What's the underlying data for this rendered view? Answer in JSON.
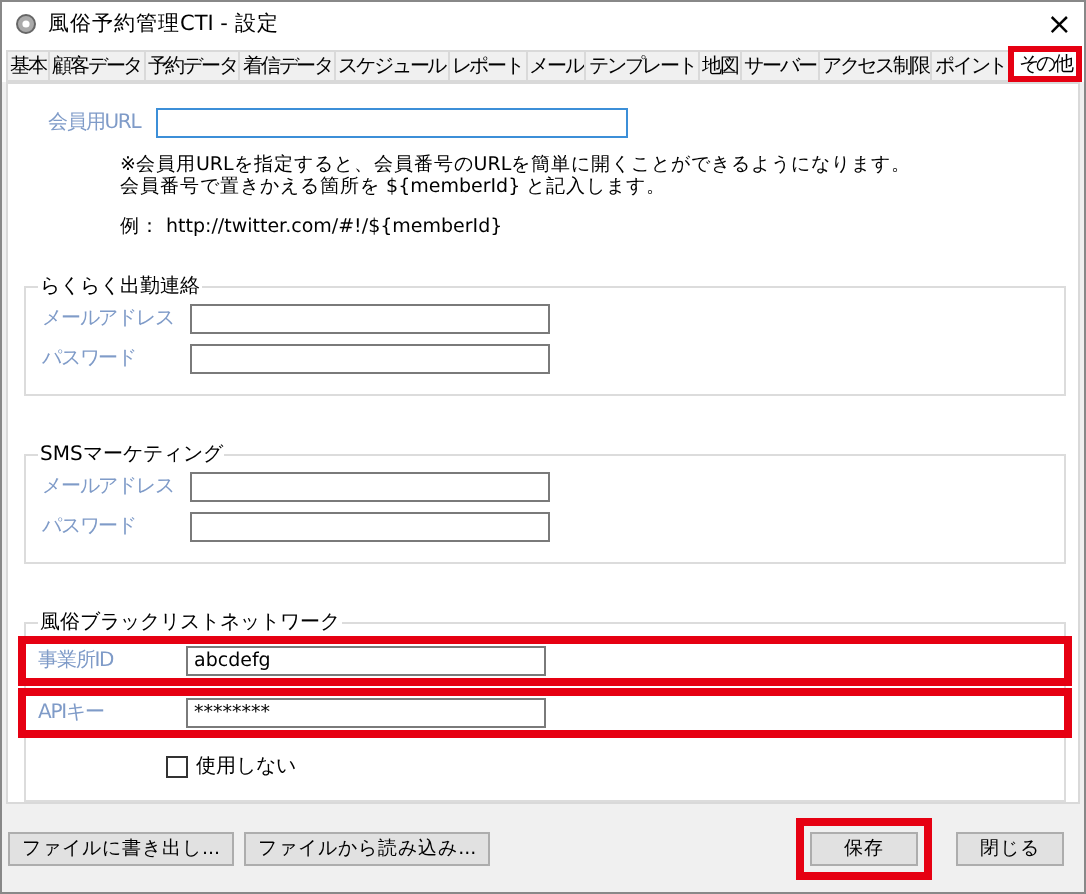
{
  "window": {
    "title": "風俗予約管理CTI - 設定",
    "close": "×"
  },
  "tabs": [
    {
      "label": "基本",
      "selected": false,
      "highlighted": false
    },
    {
      "label": "顧客データ",
      "selected": false,
      "highlighted": false
    },
    {
      "label": "予約データ",
      "selected": false,
      "highlighted": false
    },
    {
      "label": "着信データ",
      "selected": false,
      "highlighted": false
    },
    {
      "label": "スケジュール",
      "selected": false,
      "highlighted": false
    },
    {
      "label": "レポート",
      "selected": false,
      "highlighted": false
    },
    {
      "label": "メール",
      "selected": false,
      "highlighted": false
    },
    {
      "label": "テンプレート",
      "selected": false,
      "highlighted": false
    },
    {
      "label": "地図",
      "selected": false,
      "highlighted": false
    },
    {
      "label": "サーバー",
      "selected": false,
      "highlighted": false
    },
    {
      "label": "アクセス制限",
      "selected": false,
      "highlighted": false
    },
    {
      "label": "ポイント",
      "selected": false,
      "highlighted": false
    },
    {
      "label": "その他",
      "selected": true,
      "highlighted": true
    }
  ],
  "member_url": {
    "label": "会員用URL",
    "note_lines": [
      "※会員用URLを指定すると、会員番号のURLを簡単に開くことができるようになります。",
      "会員番号で置きかえる箇所を ${memberId} と記入します。"
    ],
    "example": "例： http://twitter.com/#!/${memberId}"
  },
  "groups": [
    {
      "title": "らくらく出勤連絡",
      "fields": [
        {
          "label": "メールアドレス",
          "highlighted": false
        },
        {
          "label": "パスワード",
          "highlighted": false
        }
      ]
    },
    {
      "title": "SMSマーケティング",
      "fields": [
        {
          "label": "メールアドレス",
          "highlighted": false
        },
        {
          "label": "パスワード",
          "highlighted": false
        }
      ]
    },
    {
      "title": "風俗ブラックリストネットワーク",
      "fields": [
        {
          "label": "事業所ID",
          "value": "abcdefg",
          "highlighted": true
        },
        {
          "label": "APIキー",
          "value": "********",
          "highlighted": true
        }
      ],
      "checkbox": {
        "label": "使用しない",
        "checked": false
      }
    }
  ],
  "footer": {
    "left_buttons": [
      {
        "label": "ファイルに書き出し...",
        "highlighted": false
      },
      {
        "label": "ファイルから読み込み...",
        "highlighted": false
      }
    ],
    "right_buttons": [
      {
        "label": "保存",
        "highlighted": true
      },
      {
        "label": "閉じる",
        "highlighted": false
      }
    ]
  }
}
